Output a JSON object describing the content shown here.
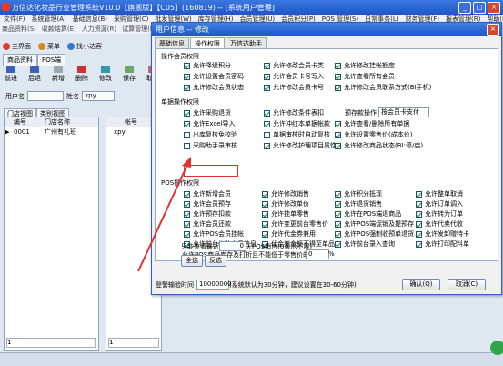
{
  "main": {
    "title": "万信达化妆品行业管理系统V10.0【旗舰版】【C05】(160819) -- [系统用户管理]",
    "menu": [
      "文件(F)",
      "系统管理(A)",
      "基础信息(B)",
      "采购管理(C)",
      "批发管理(W)",
      "库存管理(H)",
      "会员管理(U)",
      "会员积分(P)",
      "POS 管理(S)",
      "日常事务(L)",
      "财务管理(F)",
      "报表管理(R)",
      "帮助(H)"
    ],
    "menu2": [
      "商品资料(S)",
      "收款结算(E)",
      "人力资源(R)",
      "试算管理(H)"
    ],
    "toolbar": [
      "主界面",
      "菜单",
      "找小达客"
    ],
    "tabs": [
      "商品资料",
      "POS端"
    ],
    "actions": [
      "前进",
      "后退",
      "新增",
      "删除",
      "修改",
      "保存",
      "取消"
    ],
    "user_label": "用户名",
    "group_label": "姓名",
    "group_value": "xpy",
    "left_tabs": [
      "门店视图",
      "类别视图"
    ],
    "grid_headers": [
      "编号",
      "门店名称"
    ],
    "grid_rows": [
      {
        "code": "0001",
        "name": "广州有礼班"
      }
    ],
    "right_header": "帐号",
    "right_row": "xpy",
    "left_footer": "1",
    "right_footer": "1"
  },
  "dialog": {
    "title": "用户信息 -- 修改",
    "close": "×",
    "tabs": [
      "基础信息",
      "操作权限",
      "万信达助手"
    ],
    "active_tab": "操作权限",
    "sec1": "操作会员权限",
    "sec1_items": [
      {
        "label": "允许降级积分",
        "on": true
      },
      {
        "label": "允许修改会员卡类",
        "on": true
      },
      {
        "label": "允许修改挂帐额度",
        "on": true
      },
      {
        "label": "允许设置会员密码",
        "on": true
      },
      {
        "label": "允许会员卡号写入",
        "on": true
      },
      {
        "label": "允许查看所有会员",
        "on": true
      },
      {
        "label": "允许修改会员状态",
        "on": true
      },
      {
        "label": "允许修改会员卡号",
        "on": true
      },
      {
        "label": "允许修改会员联系方式(BI手机)",
        "on": true
      }
    ],
    "sec2": "单据操作权限",
    "sec2_items": [
      {
        "label": "允许采购退货",
        "on": true
      },
      {
        "label": "允许修改条件表扣",
        "on": true
      },
      {
        "label": "允许Excel导入",
        "on": true
      },
      {
        "label": "允许冲红本单据帐款",
        "on": true
      },
      {
        "label": "允许查看/删除所有单据",
        "on": true
      },
      {
        "label": "出库复核免校验",
        "on": false
      },
      {
        "label": "单据审核时自动复核",
        "on": false
      },
      {
        "label": "允许设置零售价(成本价)",
        "on": true
      },
      {
        "label": "采购助手录审核",
        "on": false
      },
      {
        "label": "允许修改护理项目属性",
        "on": true
      },
      {
        "label": "允许修改商品状态(BI:停/启)",
        "on": true
      }
    ],
    "stock_label": "预存款操作",
    "stock_value": "按会员卡支付",
    "sec3": "POS操作权限",
    "sec3_items": [
      {
        "label": "允许新增会员",
        "on": true
      },
      {
        "label": "允许修改销售",
        "on": true
      },
      {
        "label": "允许积分抵现",
        "on": true
      },
      {
        "label": "允许整单取消",
        "on": true
      },
      {
        "label": "允许会员预存",
        "on": true
      },
      {
        "label": "允许修改单价",
        "on": true
      },
      {
        "label": "允许退货销售",
        "on": true
      },
      {
        "label": "允许订单调入",
        "on": true
      },
      {
        "label": "允许预存扣款",
        "on": true
      },
      {
        "label": "允许挂单零售",
        "on": true
      },
      {
        "label": "允许在POS端退商品",
        "on": true
      },
      {
        "label": "允许转为订单",
        "on": true
      },
      {
        "label": "允许会员还款",
        "on": true
      },
      {
        "label": "允许变更前台零售价",
        "on": true
      },
      {
        "label": "允许POS端促销及提预存",
        "on": true
      },
      {
        "label": "允许代卖代收",
        "on": true
      },
      {
        "label": "允许POS会员挂帐",
        "on": true
      },
      {
        "label": "允许代金券兼用",
        "on": true
      },
      {
        "label": "允许POS强制收预单退货",
        "on": true
      },
      {
        "label": "允许发卸赠特卡",
        "on": true
      },
      {
        "label": "允许前台修改会员信息",
        "on": true
      },
      {
        "label": "代金券金额不得至单品",
        "on": true
      },
      {
        "label": "允许前台录入查询",
        "on": true
      },
      {
        "label": "允许打印配料单",
        "on": true
      }
    ],
    "pos_dept_label": "允许POS商品库存及打折且不能低于零售价的",
    "pos_dept_value": "0",
    "recent_label": "只能查看最近",
    "recent_value": "0",
    "recent_suffix": "天POS销售(0表示不限)",
    "select_all": "全选",
    "invert": "反选",
    "timeout_label": "登警输验时间",
    "timeout_value": "10000000",
    "timeout_hint": "(系统默认为30分钟，建议设置在30-60分钟)",
    "ok": "确认(Q)",
    "cancel": "取消(C)"
  },
  "colors": {
    "accent": "#1f55c8",
    "highlight": "#e03030",
    "check": "#1a8a24"
  }
}
